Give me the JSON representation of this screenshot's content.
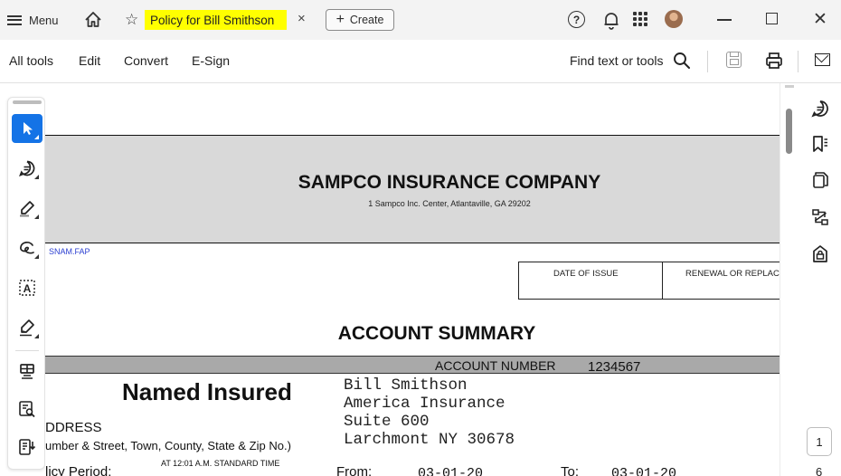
{
  "titlebar": {
    "menu_label": "Menu",
    "tab_title": "Policy for Bill Smithson",
    "tab_close": "×",
    "create_label": "Create",
    "create_plus": "+",
    "help_glyph": "?",
    "star_glyph": "☆",
    "close_glyph": "✕",
    "highlight_color": "#ffff00"
  },
  "toolbar": {
    "menu_items": [
      "All tools",
      "Edit",
      "Convert",
      "E-Sign"
    ],
    "find_label": "Find text or tools"
  },
  "left_tools": [
    {
      "icon": "select-pointer-icon",
      "active": true
    },
    {
      "icon": "comment-icon",
      "active": false
    },
    {
      "icon": "highlight-pen-icon",
      "active": false
    },
    {
      "icon": "freehand-draw-icon",
      "active": false
    },
    {
      "icon": "text-select-icon",
      "active": false
    },
    {
      "icon": "sign-pen-icon",
      "active": false
    },
    {
      "icon": "stamp-icon",
      "active": false
    },
    {
      "icon": "search-document-icon",
      "active": false
    },
    {
      "icon": "organize-pages-icon",
      "active": false
    }
  ],
  "right_tools": [
    "comments-panel-icon",
    "bookmark-icon",
    "copy-pages-icon",
    "compare-icon",
    "security-icon"
  ],
  "document": {
    "company_name": "SAMPCO INSURANCE COMPANY",
    "company_address": "1 Sampco Inc. Center, Atlantaville, GA 29202",
    "form_code": "SNAM.FAP",
    "date_of_issue_label": "DATE OF ISSUE",
    "renewal_label": "RENEWAL OR REPLAC",
    "title": "ACCOUNT SUMMARY",
    "account_number_label": "ACCOUNT NUMBER",
    "account_number": "1234567",
    "named_insured_label": "Named Insured",
    "insured_address_lines": [
      "Bill Smithson",
      "America Insurance",
      "Suite 600",
      "Larchmont NY 30678"
    ],
    "address_label": "DDRESS",
    "address_sub_label": "umber & Street, Town, County, State & Zip No.)",
    "policy_period_label": "licy Period:",
    "time_label": "AT 12:01 A.M. STANDARD TIME",
    "from_label": "From:",
    "from_date": "03-01-20",
    "to_label": "To:",
    "to_date": "03-01-20"
  },
  "pagination": {
    "current_page": "1",
    "total_pages": "6"
  },
  "colors": {
    "accent": "#1473e6",
    "company_band": "#d9d9d9",
    "account_band": "#a9a9a9",
    "form_code": "#2b3fd1"
  }
}
